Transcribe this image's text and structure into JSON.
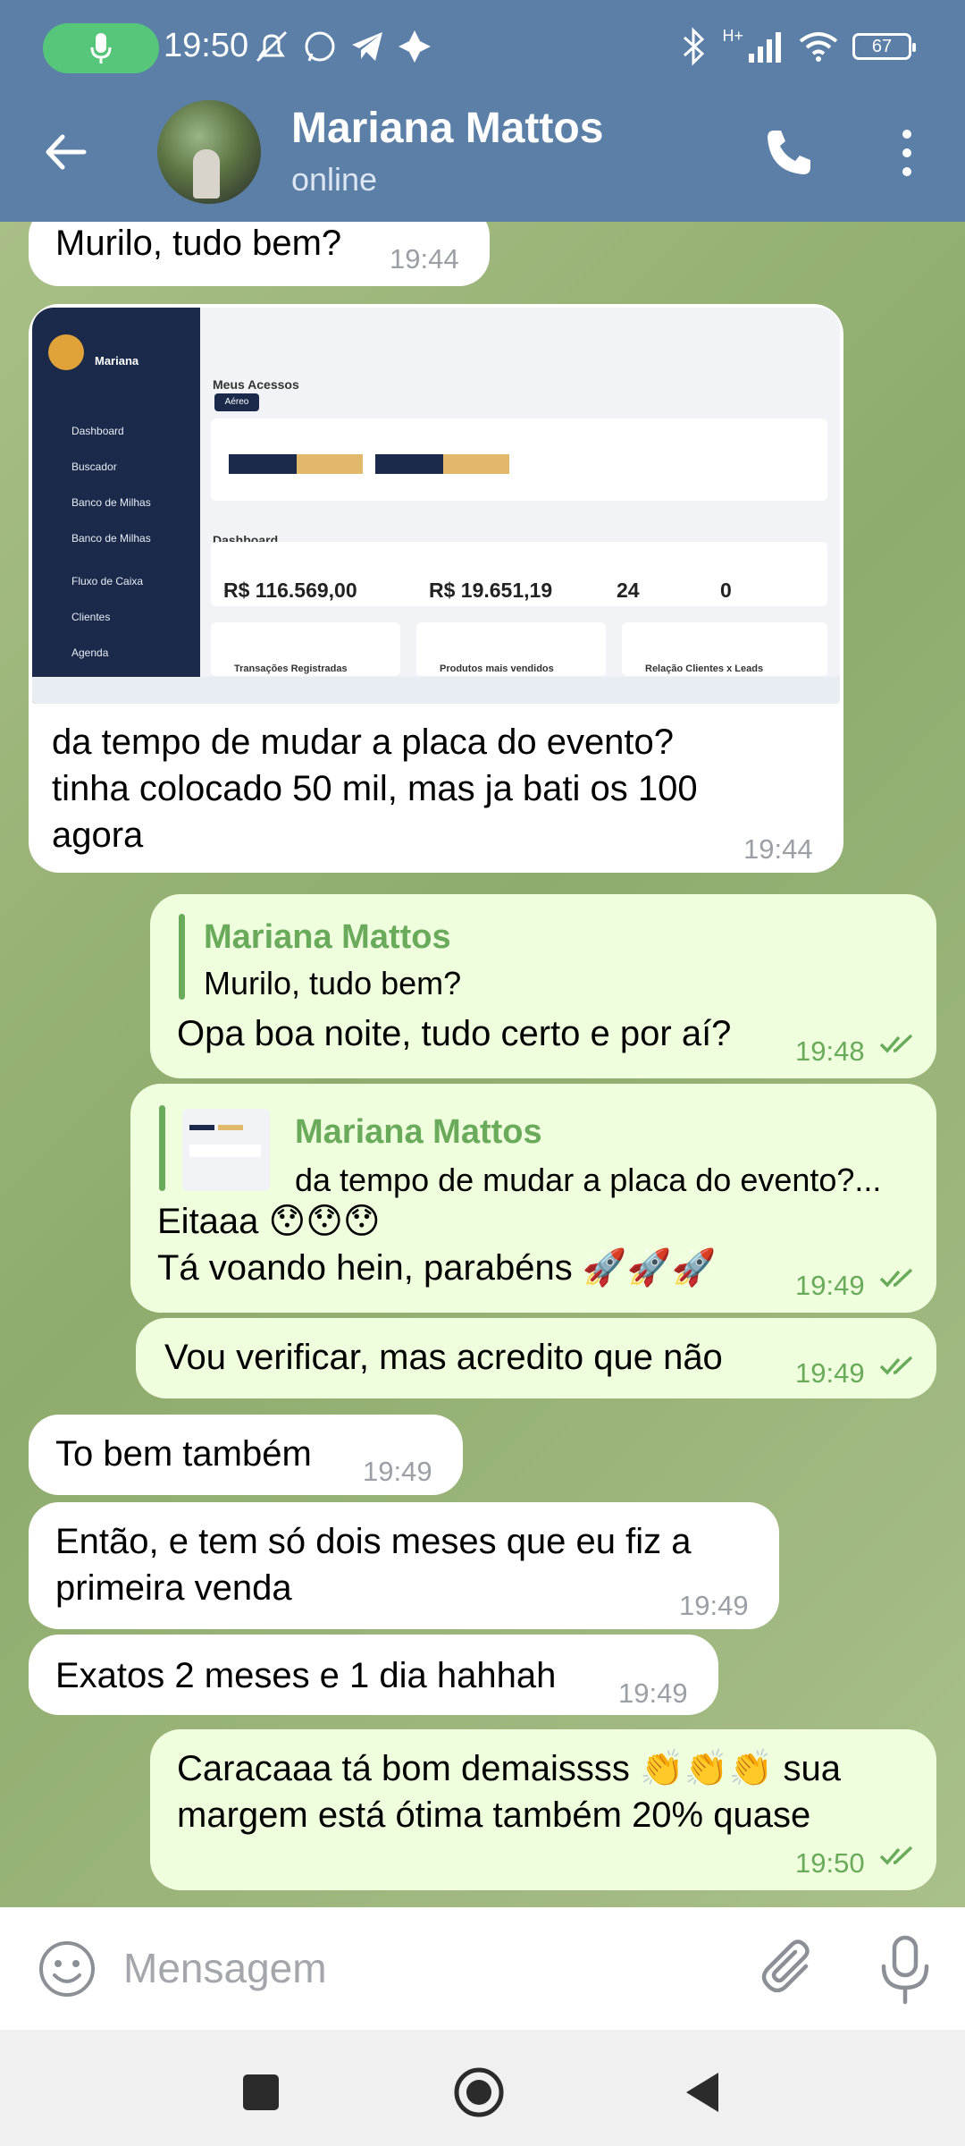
{
  "status_bar": {
    "time": "19:50",
    "network": "H+",
    "battery": "67"
  },
  "header": {
    "contact_name": "Mariana Mattos",
    "contact_status": "online"
  },
  "messages": [
    {
      "id": "m1",
      "direction": "in",
      "text": "Murilo, tudo bem?",
      "time": "19:44"
    },
    {
      "id": "m2",
      "direction": "in",
      "image": {
        "brand": "Mariana",
        "title": "Meus Acessos",
        "tab_active": "Aéreo",
        "section": "Dashboard",
        "sidebar": [
          "Dashboard",
          "Buscador",
          "Banco de Milhas",
          "Banco de Milhas",
          "Fluxo de Caixa",
          "Clientes",
          "Agenda"
        ],
        "metrics": [
          "R$ 116.569,00",
          "R$ 19.651,19",
          "24",
          "0"
        ],
        "cards": [
          "Transações Registradas",
          "Produtos mais vendidos",
          "Relação Clientes x Leads"
        ]
      },
      "text": "da tempo de mudar a placa do evento?\ntinha colocado 50 mil, mas ja bati os 100\nagora",
      "time": "19:44"
    },
    {
      "id": "m3",
      "direction": "out",
      "reply_name": "Mariana Mattos",
      "reply_text": "Murilo, tudo bem?",
      "text": "Opa boa noite, tudo certo e por aí?",
      "time": "19:48"
    },
    {
      "id": "m4",
      "direction": "out",
      "reply_name": "Mariana Mattos",
      "reply_text": "da tempo de mudar a placa do evento?...",
      "text": "Eitaaa 😯😯😯\nTá voando hein, parabéns 🚀🚀🚀",
      "time": "19:49"
    },
    {
      "id": "m5",
      "direction": "out",
      "text": "Vou verificar, mas acredito que não",
      "time": "19:49"
    },
    {
      "id": "m6",
      "direction": "in",
      "text": "To bem também",
      "time": "19:49"
    },
    {
      "id": "m7",
      "direction": "in",
      "text": "Então, e tem só dois meses que eu fiz a\nprimeira venda",
      "time": "19:49"
    },
    {
      "id": "m8",
      "direction": "in",
      "text": "Exatos 2 meses e 1 dia hahhah",
      "time": "19:49"
    },
    {
      "id": "m9",
      "direction": "out",
      "text": "Caracaaa tá bom demaissss 👏👏👏 sua\nmargem está ótima também 20% quase",
      "time": "19:50"
    }
  ],
  "input": {
    "placeholder": "Mensagem"
  },
  "colors": {
    "header": "#5b7fa7",
    "outgoing_bubble": "#efffde",
    "incoming_bubble": "#ffffff",
    "accent_green": "#6aaa5b"
  },
  "icons": [
    "back-arrow-icon",
    "phone-icon",
    "more-vertical-icon",
    "emoji-icon",
    "attach-icon",
    "microphone-icon",
    "double-check-icon"
  ]
}
